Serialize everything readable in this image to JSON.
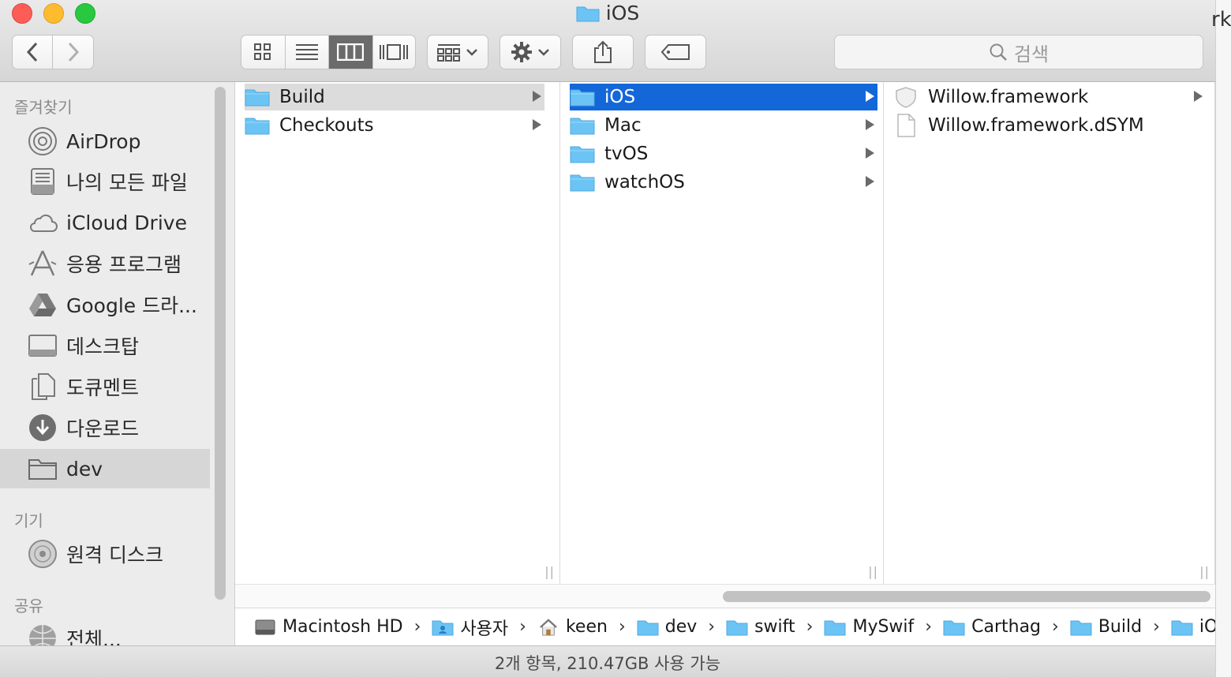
{
  "window": {
    "title": "iOS",
    "status_text": "2개 항목, 210.47GB 사용 가능"
  },
  "toolbar": {
    "search_placeholder": "검색",
    "view_mode": "column"
  },
  "sidebar": {
    "favorites_header": "즐겨찾기",
    "favorites": [
      {
        "label": "AirDrop",
        "icon": "airdrop-icon"
      },
      {
        "label": "나의 모든 파일",
        "icon": "all-files-icon"
      },
      {
        "label": "iCloud Drive",
        "icon": "cloud-icon"
      },
      {
        "label": "응용 프로그램",
        "icon": "applications-icon"
      },
      {
        "label": "Google 드라...",
        "icon": "google-drive-icon"
      },
      {
        "label": "데스크탑",
        "icon": "desktop-icon"
      },
      {
        "label": "도큐멘트",
        "icon": "documents-icon"
      },
      {
        "label": "다운로드",
        "icon": "downloads-icon"
      },
      {
        "label": "dev",
        "icon": "folder-icon",
        "selected": true
      }
    ],
    "devices_header": "기기",
    "devices": [
      {
        "label": "원격 디스크",
        "icon": "remote-disc-icon"
      }
    ],
    "shared_header": "공유",
    "shared": [
      {
        "label": "전체...",
        "icon": "network-icon"
      }
    ]
  },
  "columns": [
    {
      "items": [
        {
          "label": "Build",
          "selected": "inactive"
        },
        {
          "label": "Checkouts"
        }
      ]
    },
    {
      "items": [
        {
          "label": "iOS",
          "selected": "active"
        },
        {
          "label": "Mac"
        },
        {
          "label": "tvOS"
        },
        {
          "label": "watchOS"
        }
      ]
    },
    {
      "items": [
        {
          "label": "Willow.framework",
          "icon": "framework-icon"
        },
        {
          "label": "Willow.framework.dSYM",
          "icon": "document-icon"
        }
      ]
    }
  ],
  "pathbar": [
    {
      "label": "Macintosh HD",
      "icon": "hard-drive-icon"
    },
    {
      "label": "사용자",
      "icon": "users-folder-icon"
    },
    {
      "label": "keen",
      "icon": "home-icon"
    },
    {
      "label": "dev",
      "icon": "folder-icon"
    },
    {
      "label": "swift",
      "icon": "folder-icon"
    },
    {
      "label": "MySwif",
      "icon": "folder-icon"
    },
    {
      "label": "Carthag",
      "icon": "folder-icon"
    },
    {
      "label": "Build",
      "icon": "folder-icon"
    },
    {
      "label": "iOS",
      "icon": "folder-icon"
    }
  ],
  "background_window_text": "rk",
  "colors": {
    "selection_blue": "#1467d8",
    "folder_blue": "#6cc4f5"
  }
}
